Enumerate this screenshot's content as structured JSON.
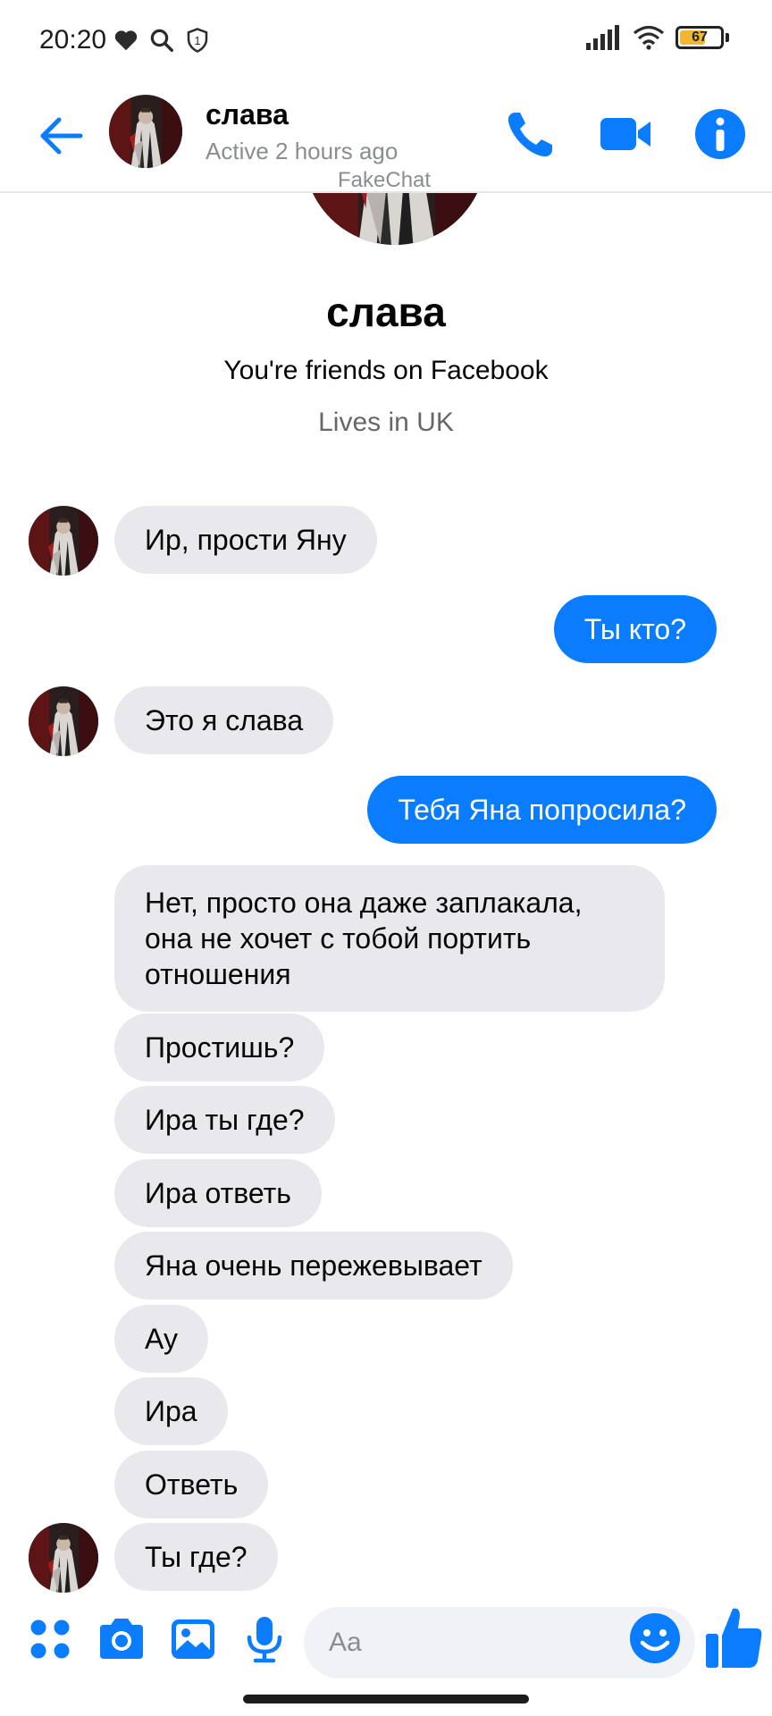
{
  "status_bar": {
    "time": "20:20",
    "battery": 67,
    "battery_label": "67",
    "left_icons": [
      "heart-icon",
      "search-icon",
      "shield-icon"
    ],
    "right_icons": [
      "signal-icon",
      "wifi-icon",
      "battery-icon"
    ]
  },
  "header": {
    "contact_name": "слава",
    "status": "Active 2 hours ago",
    "watermark": "FakeChat",
    "icons": [
      "back-arrow-icon",
      "phone-icon",
      "video-camera-icon",
      "info-icon"
    ]
  },
  "profile": {
    "name": "слава",
    "friends_text": "You're friends on Facebook",
    "location": "Lives in UK"
  },
  "messages": [
    {
      "direction": "in",
      "text": "Ир, прости Яну"
    },
    {
      "direction": "out",
      "text": "Ты кто?"
    },
    {
      "direction": "in",
      "text": "Это я слава"
    },
    {
      "direction": "out",
      "text": "Тебя Яна попросила?"
    },
    {
      "direction": "in",
      "text": "Нет, просто она даже заплакала, она не хочет с тобой портить отношения"
    },
    {
      "direction": "in",
      "text": "Простишь?"
    },
    {
      "direction": "in",
      "text": "Ира ты где?"
    },
    {
      "direction": "in",
      "text": "Ира ответь"
    },
    {
      "direction": "in",
      "text": "Яна очень пережевывает"
    },
    {
      "direction": "in",
      "text": "Ау"
    },
    {
      "direction": "in",
      "text": "Ира"
    },
    {
      "direction": "in",
      "text": "Ответь"
    },
    {
      "direction": "in",
      "text": "Ты где?"
    }
  ],
  "composer": {
    "placeholder": "Aa",
    "icons": [
      "apps-icon",
      "camera-icon",
      "gallery-icon",
      "microphone-icon",
      "emoji-icon",
      "thumbs-up-icon"
    ]
  },
  "colors": {
    "accent": "#0a7cff",
    "incoming_bubble": "#e9e8ec",
    "outgoing_bubble": "#0a7cff",
    "secondary_text": "#65676b"
  }
}
